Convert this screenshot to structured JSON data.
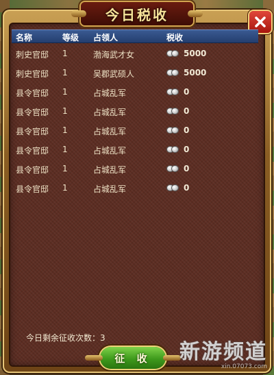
{
  "dialog": {
    "title": "今日税收",
    "close_icon": "close-x-icon"
  },
  "table": {
    "headers": {
      "name": "名称",
      "level": "等级",
      "occupant": "占领人",
      "tax": "税收"
    },
    "rows": [
      {
        "name": "刺史官邸",
        "level": "1",
        "occupant": "渤海武才女",
        "tax": "5000"
      },
      {
        "name": "刺史官邸",
        "level": "1",
        "occupant": "吴郡武硕人",
        "tax": "5000"
      },
      {
        "name": "县令官邸",
        "level": "1",
        "occupant": "占城乱军",
        "tax": "0"
      },
      {
        "name": "县令官邸",
        "level": "1",
        "occupant": "占城乱军",
        "tax": "0"
      },
      {
        "name": "县令官邸",
        "level": "1",
        "occupant": "占城乱军",
        "tax": "0"
      },
      {
        "name": "县令官邸",
        "level": "1",
        "occupant": "占城乱军",
        "tax": "0"
      },
      {
        "name": "县令官邸",
        "level": "1",
        "occupant": "占城乱军",
        "tax": "0"
      },
      {
        "name": "县令官邸",
        "level": "1",
        "occupant": "占城乱军",
        "tax": "0"
      }
    ]
  },
  "footer": {
    "remaining_label": "今日剩余征收次数：3",
    "collect_label": "征 收"
  },
  "watermark": {
    "main": "新游频道",
    "sub": "xin.07073.com"
  },
  "colors": {
    "header_blue": "#2c4a80",
    "panel_brown": "#5c2d22",
    "gold_frame": "#c9a054",
    "close_red": "#c3271b",
    "collect_green": "#3e9a1c"
  }
}
